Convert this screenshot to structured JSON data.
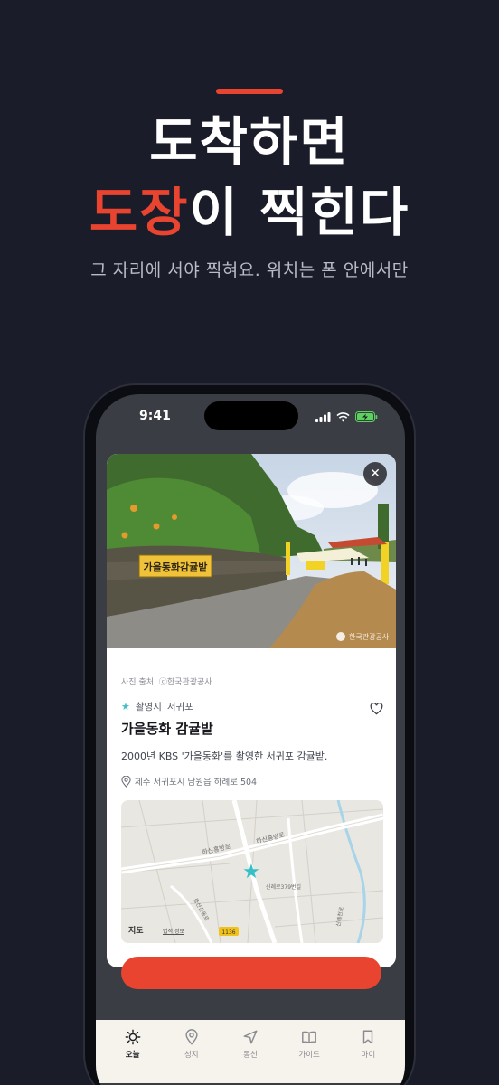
{
  "hero": {
    "title_line1": "도착하면",
    "title_accent": "도장",
    "title_line2_rest": "이 찍힌다",
    "subtitle": "그 자리에 서야 찍혀요. 위치는 폰 안에서만"
  },
  "status_bar": {
    "time": "9:41"
  },
  "card": {
    "photo_credit": "사진 출처: ⓒ한국관광공사",
    "photo_sign_text": "가을동화감귤밭",
    "photo_watermark": "한국관광공사",
    "tag_type": "촬영지",
    "tag_region": "서귀포",
    "title": "가을동화 감귤밭",
    "description": "2000년 KBS '가을동화'를 촬영한 서귀포 감귤밭.",
    "address": "제주 서귀포시 남원읍 하례로 504",
    "map": {
      "logo": "지도",
      "legal_link": "법적 정보",
      "road_labels": [
        "하신흥방로",
        "하신흥방로",
        "신례로379번길",
        "1136",
        "중산간동로",
        "신례천로"
      ]
    }
  },
  "tabs": [
    {
      "label": "오늘",
      "icon": "sun-icon",
      "active": true
    },
    {
      "label": "성지",
      "icon": "map-pin-icon",
      "active": false
    },
    {
      "label": "동선",
      "icon": "navigation-arrow-icon",
      "active": false
    },
    {
      "label": "가이드",
      "icon": "book-icon",
      "active": false
    },
    {
      "label": "마이",
      "icon": "bookmark-icon",
      "active": false
    }
  ],
  "colors": {
    "background": "#1a1d29",
    "accent": "#e8442f",
    "star": "#3fc0c7"
  }
}
